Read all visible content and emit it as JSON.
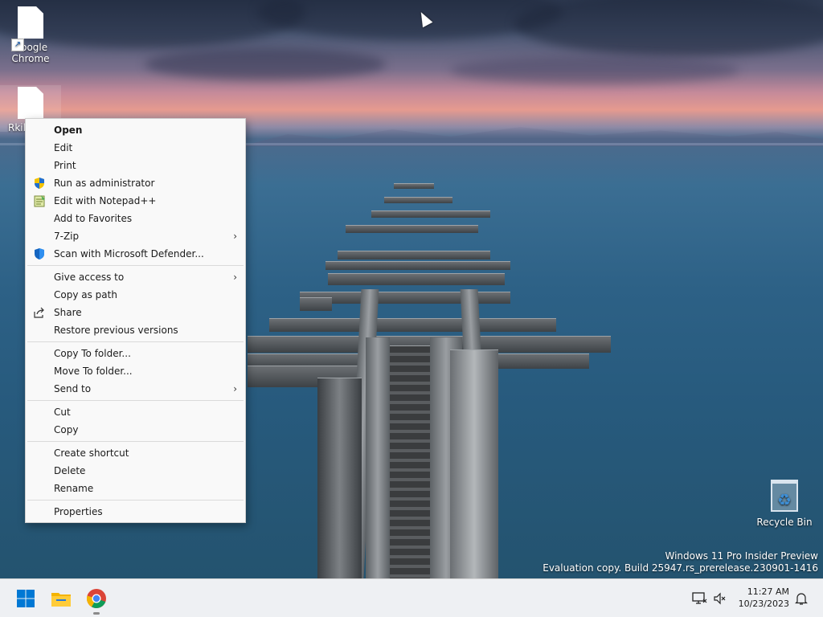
{
  "desktop": {
    "icons": [
      {
        "label": "Google\nChrome",
        "line1": "Google",
        "line2": "Chrome"
      },
      {
        "label": "Rkil"
      }
    ],
    "recycle_bin": {
      "label": "Recycle Bin"
    }
  },
  "context_menu": {
    "items": [
      {
        "label": "Open"
      },
      {
        "label": "Edit"
      },
      {
        "label": "Print"
      },
      {
        "label": "Run as administrator",
        "icon": "shield-uac-icon"
      },
      {
        "label": "Edit with Notepad++",
        "icon": "notepadpp-icon"
      },
      {
        "label": "Add to Favorites"
      },
      {
        "label": "7-Zip"
      },
      {
        "label": "Scan with Microsoft Defender...",
        "icon": "defender-shield-icon"
      },
      {
        "label": "Give access to"
      },
      {
        "label": "Copy as path"
      },
      {
        "label": "Share",
        "icon": "share-icon"
      },
      {
        "label": "Restore previous versions"
      },
      {
        "label": "Copy To folder..."
      },
      {
        "label": "Move To folder..."
      },
      {
        "label": "Send to"
      },
      {
        "label": "Cut"
      },
      {
        "label": "Copy"
      },
      {
        "label": "Create shortcut"
      },
      {
        "label": "Delete"
      },
      {
        "label": "Rename"
      },
      {
        "label": "Properties"
      }
    ],
    "submenu_glyph": "›"
  },
  "watermark": {
    "line1": "Windows 11 Pro Insider Preview",
    "line2": "Evaluation copy. Build 25947.rs_prerelease.230901-1416"
  },
  "taskbar": {
    "time": "11:27 AM",
    "date": "10/23/2023"
  },
  "colors": {
    "accent": "#0067c0",
    "menu_bg": "#f9f9f9",
    "taskbar_bg": "#eef0f3"
  }
}
